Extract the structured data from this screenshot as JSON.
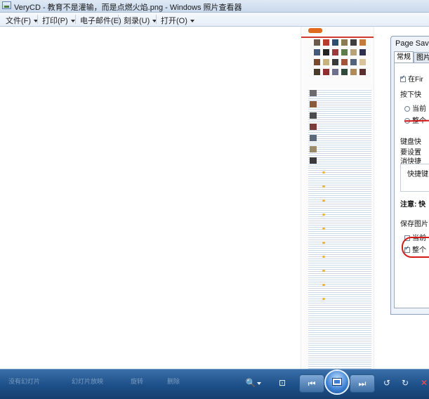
{
  "window": {
    "title": "VeryCD - 教育不是灌输，而是点燃火焰.png - Windows 照片查看器"
  },
  "menu": {
    "items": [
      {
        "label": "文件(F)"
      },
      {
        "label": "打印(P)"
      },
      {
        "label": "电子邮件(E)"
      },
      {
        "label": "刻录(U)"
      },
      {
        "label": "打开(O)"
      }
    ]
  },
  "dialog": {
    "title": "Page Saver",
    "tabs": [
      "常规",
      "图片"
    ],
    "option_fir": "在Fir",
    "section_shortcut": "按下快",
    "radio_current": "当前",
    "radio_whole": "整个",
    "section_keyboard": "键盘快",
    "line_set": "要设置",
    "line_cancel": "消快捷",
    "field_shortcut": "快捷键",
    "note": "注意: 快",
    "section_save": "保存图片",
    "check_current": "当前",
    "check_whole": "整个"
  },
  "taskbar": {
    "ghost_labels": [
      "没有幻灯片",
      "幻灯片放映",
      "旋转",
      "删除"
    ]
  },
  "icons": {
    "zoom": "zoom-magnifier-icon",
    "fit": "fit-to-window-icon",
    "prev": "previous-image-icon",
    "slideshow": "slideshow-icon",
    "next": "next-image-icon",
    "rotate_ccw": "rotate-counterclockwise-icon",
    "rotate_cw": "rotate-clockwise-icon",
    "delete": "delete-icon"
  },
  "colors": {
    "annotation": "#d21a1a",
    "taskbar": "#1d4f88"
  }
}
